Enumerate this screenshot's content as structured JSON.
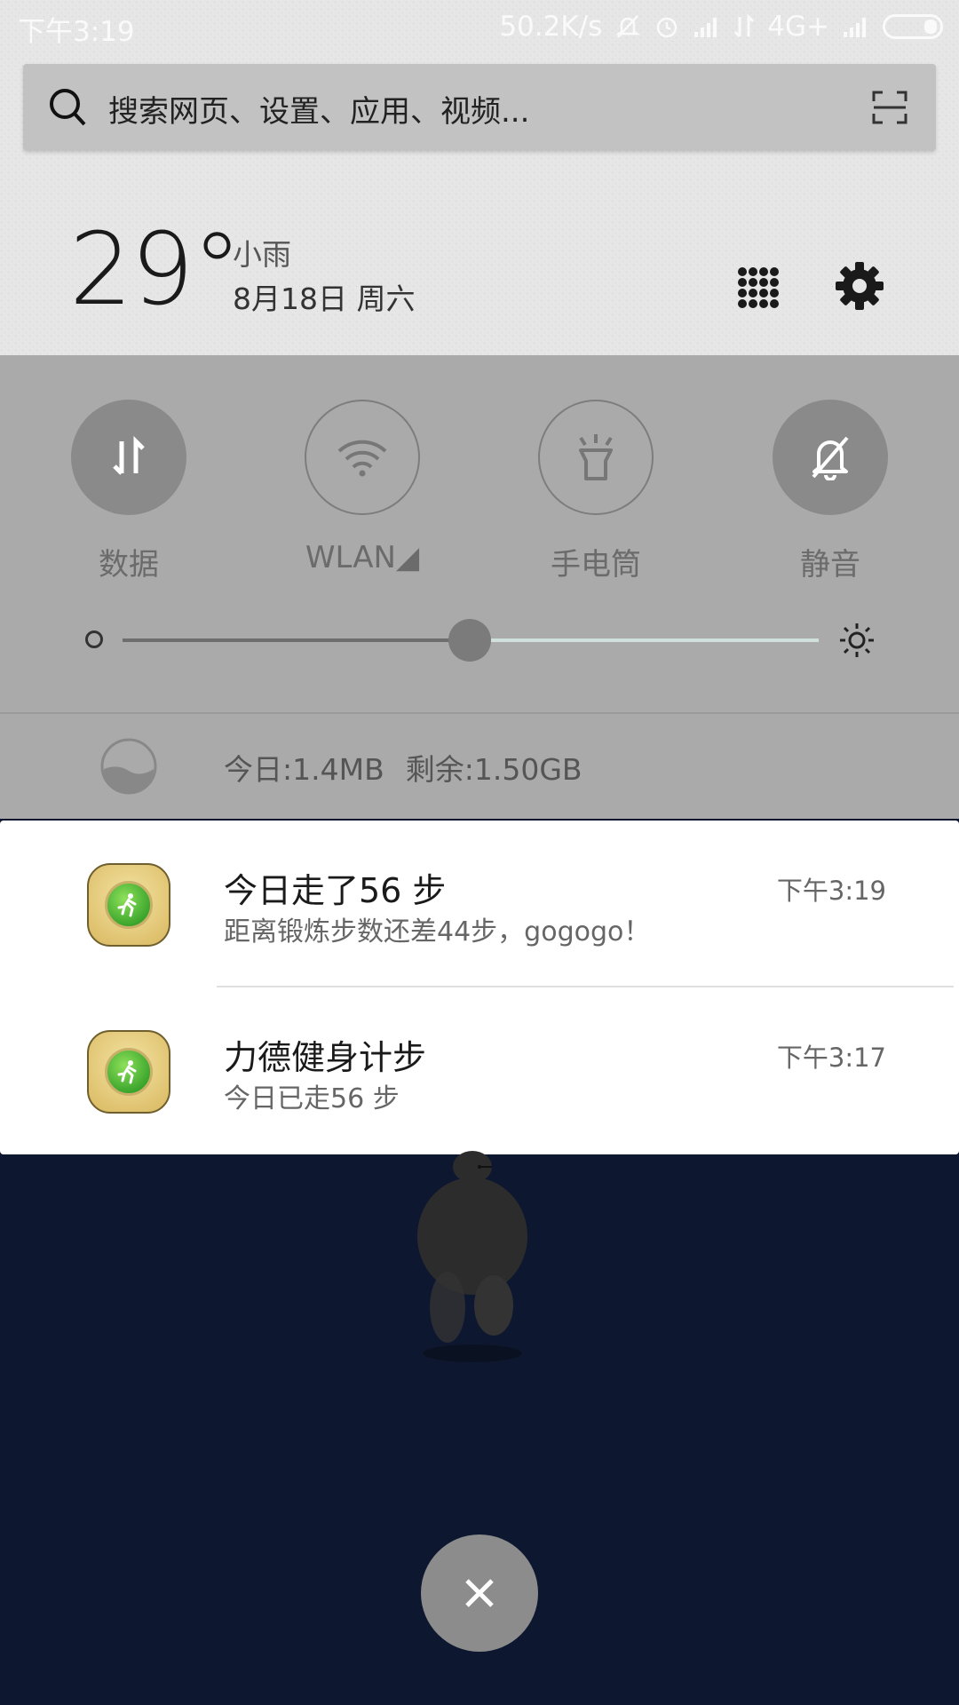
{
  "status_bar": {
    "time": "下午3:19",
    "network_speed": "50.2K/s",
    "network_type": "4G+",
    "icons": [
      "mute-icon",
      "alarm-icon",
      "signal-icon",
      "data-arrows-icon",
      "signal-icon",
      "battery-icon"
    ]
  },
  "search": {
    "placeholder": "搜索网页、设置、应用、视频..."
  },
  "weather": {
    "temperature": "29°",
    "condition": "小雨",
    "date": "8月18日 周六"
  },
  "toggles": [
    {
      "label": "数据",
      "icon": "data-arrows-icon",
      "active": true
    },
    {
      "label": "WLAN◢",
      "icon": "wifi-icon",
      "active": false
    },
    {
      "label": "手电筒",
      "icon": "flashlight-icon",
      "active": false
    },
    {
      "label": "静音",
      "icon": "mute-icon",
      "active": true
    }
  ],
  "brightness": {
    "level": 0.52
  },
  "data_usage": {
    "today": "今日:1.4MB",
    "remaining": "剩余:1.50GB"
  },
  "notifications": [
    {
      "app_icon": "runner-icon",
      "title": "今日走了56 步",
      "text": "距离锻炼步数还差44步，gogogo！",
      "time": "下午3:19"
    },
    {
      "app_icon": "runner-icon",
      "title": "力德健身计步",
      "text": "今日已走56 步",
      "time": "下午3:17"
    }
  ],
  "colors": {
    "panel_gray": "#aaaaaa",
    "top_bg": "#e6e6e6",
    "dark_bg": "#0d1830",
    "slider_active": "#6e6e6e",
    "slider_inactive": "#cfe0dd"
  }
}
